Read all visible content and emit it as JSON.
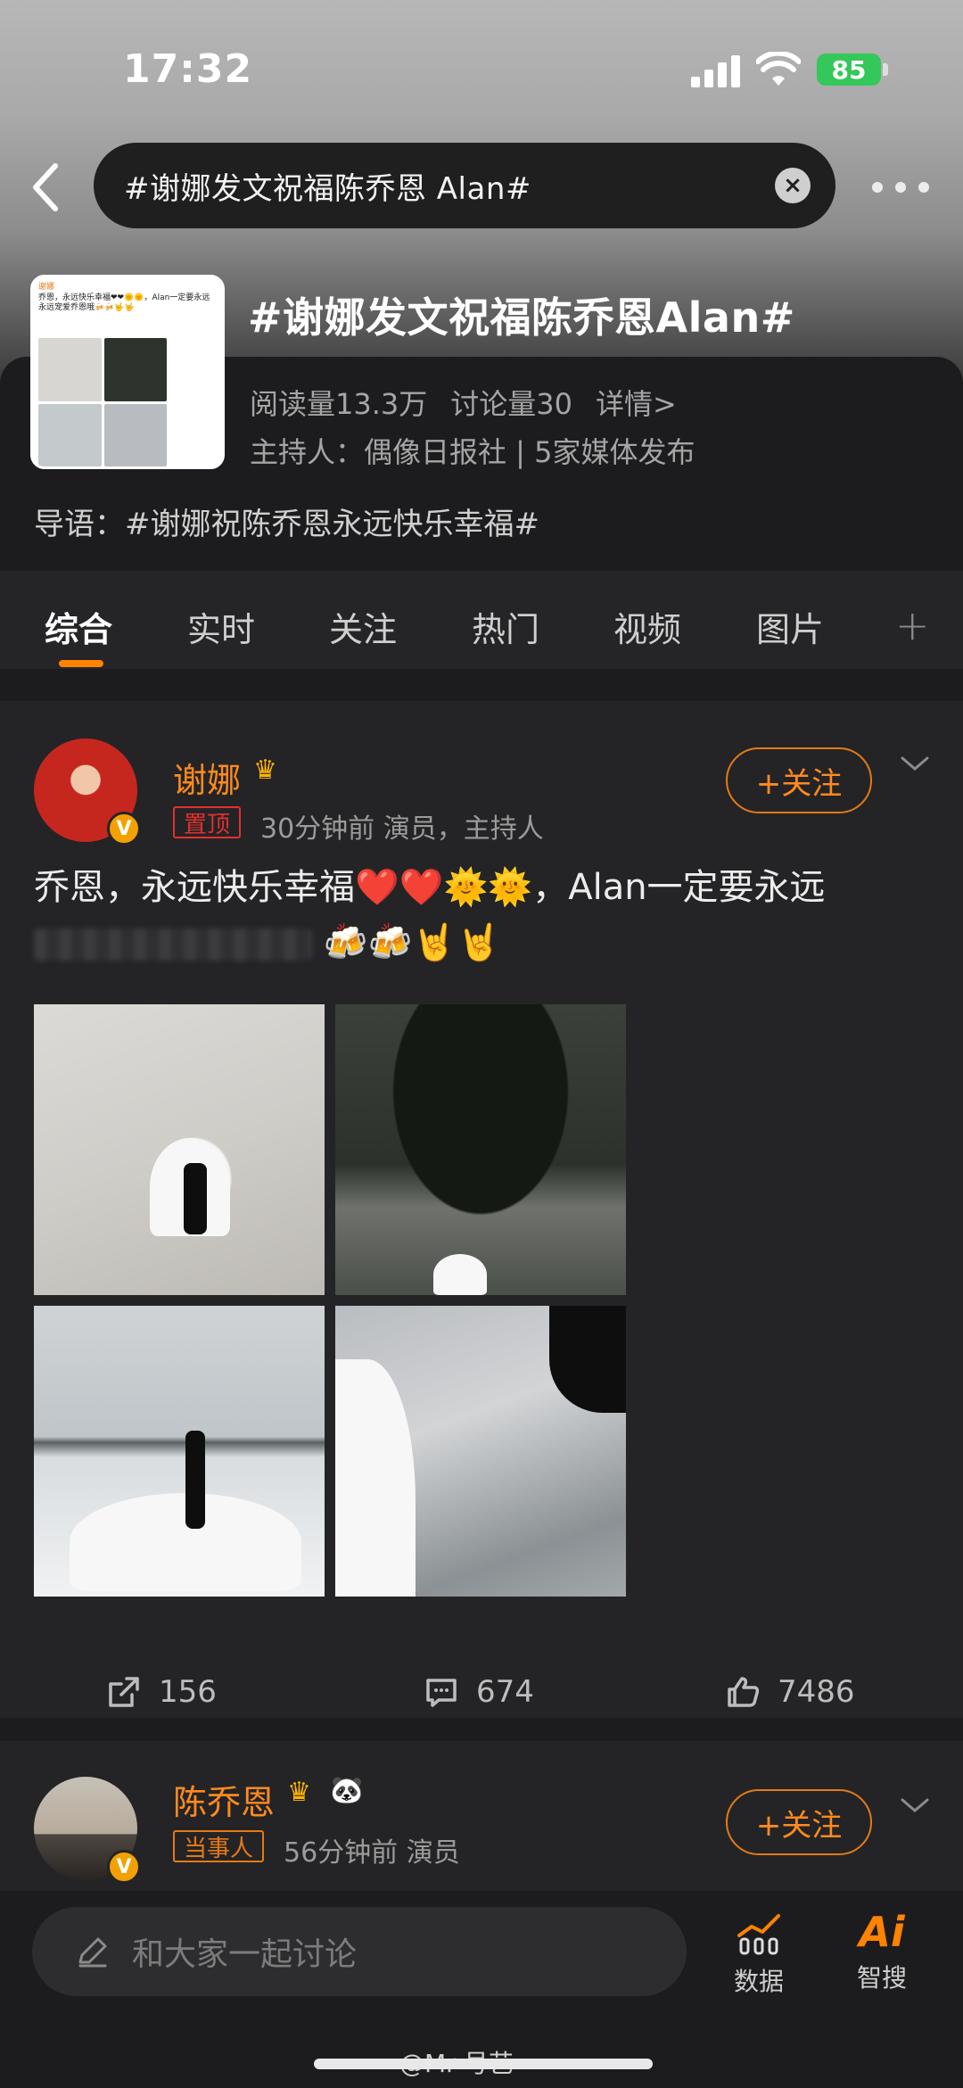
{
  "status": {
    "time": "17:32",
    "battery": "85"
  },
  "search": {
    "query": "#谢娜发文祝福陈乔恩 Alan#"
  },
  "topic": {
    "title": "#谢娜发文祝福陈乔恩Alan#",
    "reads": "阅读量13.3万",
    "discussions": "讨论量30",
    "details": "详情>",
    "host": "主持人：偶像日报社 | 5家媒体发布",
    "guide": "导语：#谢娜祝陈乔恩永远快乐幸福#",
    "thumb_name": "谢娜",
    "thumb_text": "乔恩，永远快乐幸福❤❤🌞🌞，Alan一定要永远永远宠爱乔恩哦🍻🍻🤟🤟"
  },
  "tabs": [
    "综合",
    "实时",
    "关注",
    "热门",
    "视频",
    "图片"
  ],
  "posts": [
    {
      "name": "谢娜",
      "tag": "置顶",
      "meta": "30分钟前  演员，主持人",
      "follow": "+关注",
      "text_line1": "乔恩，永远快乐幸福❤️❤️🌞🌞，Alan一定要永远",
      "emojis_line2": "🍻🍻🤘🤘",
      "stats": {
        "shares": "156",
        "comments": "674",
        "likes": "7486"
      }
    },
    {
      "name": "陈乔恩",
      "tag": "当事人",
      "meta": "56分钟前  演员",
      "follow": "+关注"
    }
  ],
  "bottom": {
    "discuss_placeholder": "和大家一起讨论",
    "data_label": "数据",
    "ai_label": "智搜",
    "ai_mark": "Ai"
  },
  "watermark": "@Mr-号艺"
}
